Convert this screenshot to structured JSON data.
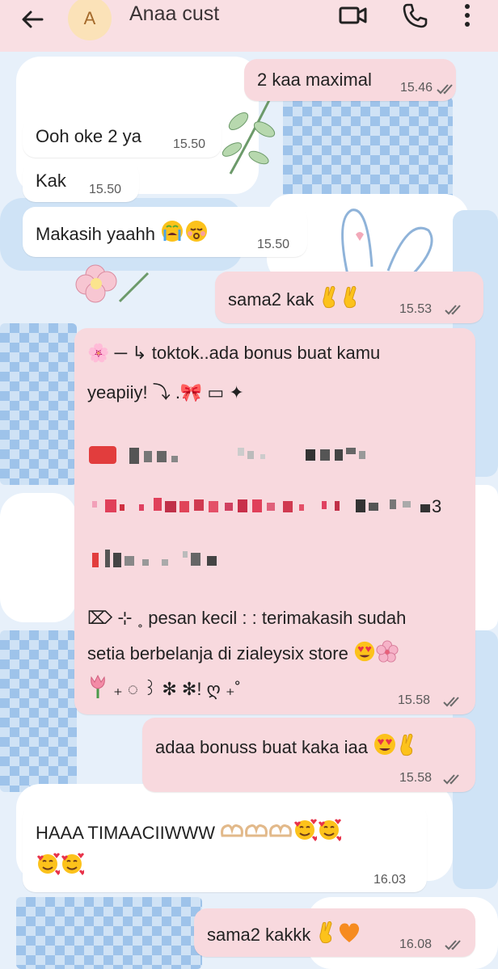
{
  "header": {
    "avatar_letter": "A",
    "contact_name": "Anaa cust"
  },
  "messages": [
    {
      "id": "m1",
      "direction": "out",
      "text": "2 kaa maximal",
      "time": "15.46"
    },
    {
      "id": "m2",
      "direction": "in",
      "text": "Ooh oke 2 ya",
      "time": "15.50"
    },
    {
      "id": "m3",
      "direction": "in",
      "text": "Kak",
      "time": "15.50"
    },
    {
      "id": "m4",
      "direction": "in",
      "text": "Makasih yaahh",
      "emojis": [
        "loudly-crying-face",
        "kissing-face-closed-eyes"
      ],
      "time": "15.50"
    },
    {
      "id": "m5",
      "direction": "out",
      "text": "sama2 kak",
      "emojis": [
        "crossed-fingers",
        "crossed-fingers"
      ],
      "time": "15.53"
    },
    {
      "id": "m6",
      "direction": "out",
      "lines": [
        "🌸 ─ ↳ toktok..ada bonus buat kamu",
        "yeapiiy! ⤵ .🎀 ▭ ✦",
        "pesan kecil : : terimakasih sudah",
        "setia berbelanja di zialeysix store",
        "₊ ◌ ꒱ ✻ ✻! ღ ₊˚"
      ],
      "prefix_symbol": "⌦ ⊹ ˳",
      "blurred_line_end": "3",
      "time": "15.58"
    },
    {
      "id": "m7",
      "direction": "out",
      "text": "adaa bonuss buat kaka iaa",
      "emojis": [
        "heart-eyes",
        "crossed-fingers"
      ],
      "time": "15.58"
    },
    {
      "id": "m8",
      "direction": "in",
      "text": "HAAA TIMAACIIWWW",
      "emojis": [
        "heart-hands",
        "heart-hands",
        "heart-hands",
        "smiling-face-hearts",
        "smiling-face-hearts",
        "smiling-face-hearts",
        "smiling-face-hearts"
      ],
      "time": "16.03"
    },
    {
      "id": "m9",
      "direction": "out",
      "text": "sama2 kakkk",
      "emojis": [
        "crossed-fingers",
        "orange-heart"
      ],
      "time": "16.08"
    }
  ],
  "colors": {
    "header_bg": "#f9dfe3",
    "outgoing_bubble": "#f8d9de",
    "incoming_bubble": "#ffffff",
    "tick_color": "#6b6b6b"
  }
}
